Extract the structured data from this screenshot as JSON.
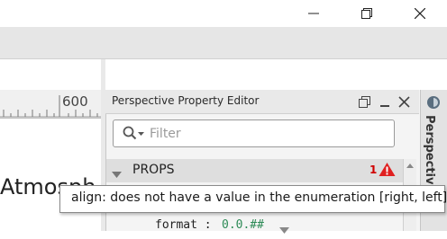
{
  "window": {
    "controls": [
      "minimize-icon",
      "restore-icon",
      "close-icon"
    ]
  },
  "canvas": {
    "ruler_label": "600",
    "text": "Atmosph"
  },
  "property_editor": {
    "title": "Perspective Property Editor",
    "search": {
      "placeholder": "Filter",
      "value": ""
    },
    "section": {
      "label": "PROPS",
      "error_count": "1"
    },
    "property_row": {
      "key": "format :",
      "value": "0.0.##"
    },
    "header_icons": [
      "float-window-icon",
      "minimize-panel-icon",
      "close-panel-icon"
    ]
  },
  "side_tab": {
    "label": "Perspective"
  },
  "tooltip": {
    "text": "align: does not have a value in the enumeration [right, left]"
  },
  "colors": {
    "error_red": "#d00000",
    "warning_red": "#e02020",
    "value_green": "#2e8b57"
  }
}
